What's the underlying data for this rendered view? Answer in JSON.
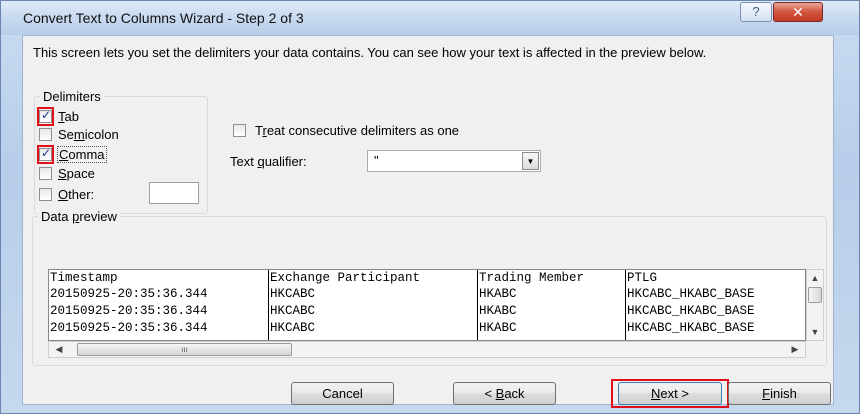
{
  "window": {
    "title": "Convert Text to Columns Wizard - Step 2 of 3",
    "help_glyph": "?",
    "close_glyph": "✕"
  },
  "description": "This screen lets you set the delimiters your data contains.  You can see how your text is affected in the preview below.",
  "delimiters": {
    "group_label": "Delimiters",
    "tab": {
      "label": "Tab",
      "checked": true
    },
    "semicolon": {
      "label": "Semicolon",
      "checked": false
    },
    "comma": {
      "label": "Comma",
      "checked": true
    },
    "space": {
      "label": "Space",
      "checked": false
    },
    "other": {
      "label": "Other:",
      "checked": false,
      "value": ""
    }
  },
  "options": {
    "treat_consecutive": {
      "label": "Treat consecutive delimiters as one",
      "checked": false
    },
    "text_qualifier": {
      "label": "Text qualifier:",
      "value": "\""
    }
  },
  "preview": {
    "group_label": "Data preview",
    "columns": [
      "Timestamp",
      "Exchange Participant",
      "Trading Member",
      "PTLG"
    ],
    "rows": [
      [
        "20150925-20:35:36.344",
        "HKCABC",
        "HKABC",
        "HKCABC_HKABC_BASE"
      ],
      [
        "20150925-20:35:36.344",
        "HKCABC",
        "HKABC",
        "HKCABC_HKABC_BASE"
      ],
      [
        "20150925-20:35:36.344",
        "HKCABC",
        "HKABC",
        "HKCABC_HKABC_BASE"
      ]
    ]
  },
  "buttons": {
    "cancel": "Cancel",
    "back": "< Back",
    "next": "Next >",
    "finish": "Finish"
  },
  "colors": {
    "highlight": "#e0101a"
  }
}
